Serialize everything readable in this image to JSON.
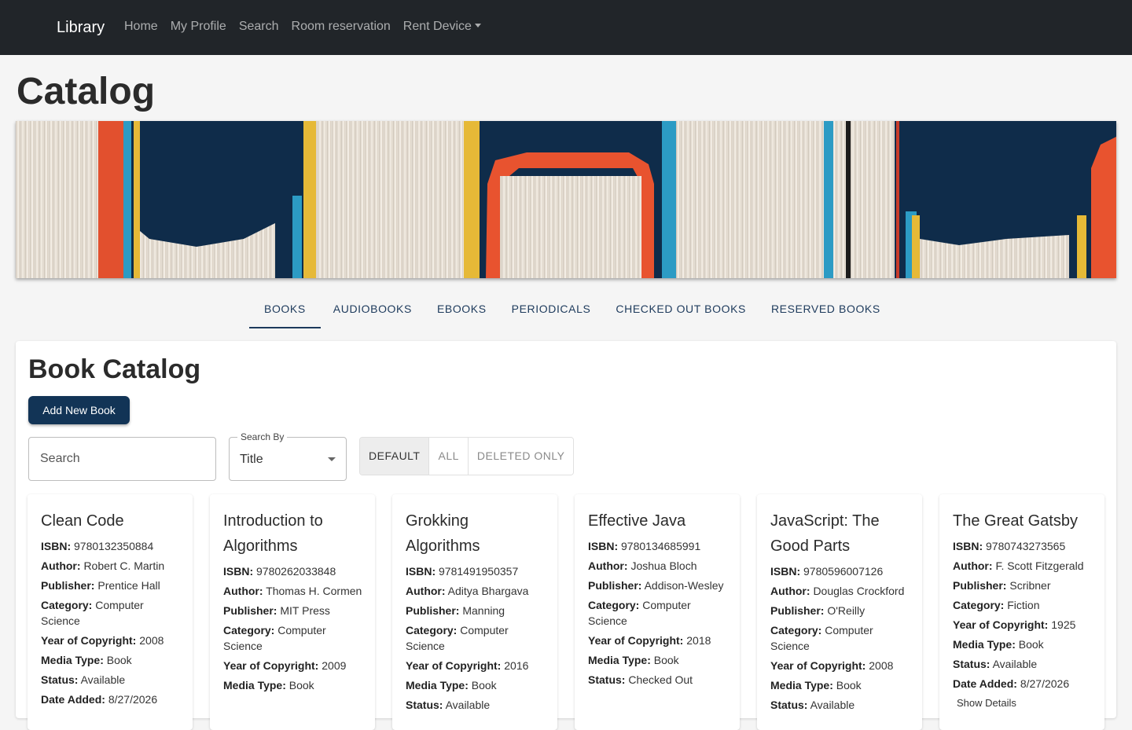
{
  "navbar": {
    "brand": "Library",
    "links": [
      "Home",
      "My Profile",
      "Search",
      "Room reservation",
      "Rent Device"
    ]
  },
  "page_title": "Catalog",
  "tabs": [
    "Books",
    "Audiobooks",
    "Ebooks",
    "Periodicals",
    "Checked Out Books",
    "Reserved Books"
  ],
  "catalog": {
    "title": "Book Catalog",
    "add_button": "Add New Book",
    "search_placeholder": "Search",
    "search_by_label": "Search By",
    "search_by_value": "Title",
    "filters": [
      "Default",
      "All",
      "Deleted Only"
    ]
  },
  "field_labels": {
    "isbn": "ISBN:",
    "author": "Author:",
    "publisher": "Publisher:",
    "category": "Category:",
    "year": "Year of Copyright:",
    "media": "Media Type:",
    "status": "Status:",
    "date": "Date Added:"
  },
  "books": [
    {
      "title": "Clean Code",
      "isbn": "9780132350884",
      "author": "Robert C. Martin",
      "publisher": "Prentice Hall",
      "category": "Computer Science",
      "year": "2008",
      "media": "Book",
      "status": "Available",
      "date": "8/27/2026"
    },
    {
      "title": "Introduction to Algorithms",
      "isbn": "9780262033848",
      "author": "Thomas H. Cormen",
      "publisher": "MIT Press",
      "category": "Computer Science",
      "year": "2009",
      "media": "Book"
    },
    {
      "title": "Grokking Algorithms",
      "isbn": "9781491950357",
      "author": "Aditya Bhargava",
      "publisher": "Manning",
      "category": "Computer Science",
      "year": "2016",
      "media": "Book",
      "status": "Available"
    },
    {
      "title": "Effective Java",
      "isbn": "9780134685991",
      "author": "Joshua Bloch",
      "publisher": "Addison-Wesley",
      "category": "Computer Science",
      "year": "2018",
      "media": "Book",
      "status": "Checked Out"
    },
    {
      "title": "JavaScript: The Good Parts",
      "isbn": "9780596007126",
      "author": "Douglas Crockford",
      "publisher": "O'Reilly",
      "category": "Computer Science",
      "year": "2008",
      "media": "Book",
      "status": "Available"
    },
    {
      "title": "The Great Gatsby",
      "isbn": "9780743273565",
      "author": "F. Scott Fitzgerald",
      "publisher": "Scribner",
      "category": "Fiction",
      "year": "1925",
      "media": "Book",
      "status": "Available",
      "date": "8/27/2026",
      "details": "Show Details"
    }
  ],
  "colors": {
    "navbar": "#212529",
    "primary": "#123456",
    "tab_text": "#1d3a5c",
    "banner_bg": "#0f2c4a"
  }
}
